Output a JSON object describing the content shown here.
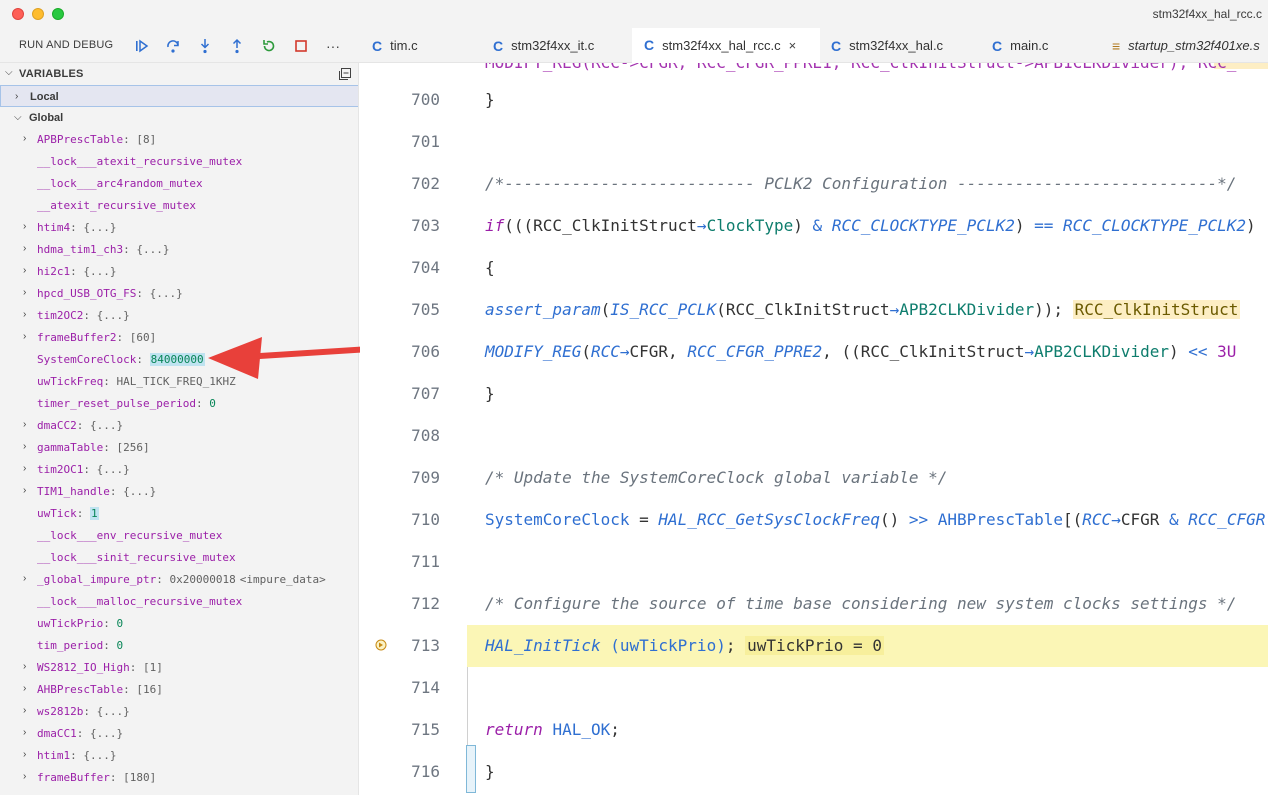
{
  "window": {
    "title": "stm32f4xx_hal_rcc.c"
  },
  "debug_toolbar": {
    "title": "RUN AND DEBUG",
    "buttons": [
      "continue-icon",
      "step-over-icon",
      "step-into-icon",
      "step-out-icon",
      "restart-icon",
      "stop-icon",
      "more-icon"
    ],
    "more_label": "···"
  },
  "tabs": [
    {
      "label": "tim.c",
      "active": false
    },
    {
      "label": "stm32f4xx_it.c",
      "active": false
    },
    {
      "label": "stm32f4xx_hal_rcc.c",
      "active": true,
      "close": "×"
    },
    {
      "label": "stm32f4xx_hal.c",
      "active": false
    },
    {
      "label": "main.c",
      "active": false
    },
    {
      "label": "startup_stm32f401xe.s",
      "active": false,
      "italic": true
    }
  ],
  "variables": {
    "header": "VARIABLES",
    "scopes": {
      "local": "Local",
      "global": "Global"
    },
    "items": [
      {
        "name": "APBPrescTable",
        "value": "[8]",
        "expandable": true,
        "kind": "plain"
      },
      {
        "name": "__lock___atexit_recursive_mutex",
        "value": "",
        "expandable": false,
        "kind": "plain"
      },
      {
        "name": "__lock___arc4random_mutex",
        "value": "",
        "expandable": false,
        "kind": "plain"
      },
      {
        "name": "__atexit_recursive_mutex",
        "value": "",
        "expandable": false,
        "kind": "plain"
      },
      {
        "name": "htim4",
        "value": "{...}",
        "expandable": true,
        "kind": "plain"
      },
      {
        "name": "hdma_tim1_ch3",
        "value": "{...}",
        "expandable": true,
        "kind": "plain"
      },
      {
        "name": "hi2c1",
        "value": "{...}",
        "expandable": true,
        "kind": "plain"
      },
      {
        "name": "hpcd_USB_OTG_FS",
        "value": "{...}",
        "expandable": true,
        "kind": "plain"
      },
      {
        "name": "tim2OC2",
        "value": "{...}",
        "expandable": true,
        "kind": "plain"
      },
      {
        "name": "frameBuffer2",
        "value": "[60]",
        "expandable": true,
        "kind": "plain"
      },
      {
        "name": "SystemCoreClock",
        "value": "84000000",
        "expandable": false,
        "kind": "highlight"
      },
      {
        "name": "uwTickFreq",
        "value": "HAL_TICK_FREQ_1KHZ",
        "expandable": false,
        "kind": "plain"
      },
      {
        "name": "timer_reset_pulse_period",
        "value": "0",
        "expandable": false,
        "kind": "number"
      },
      {
        "name": "dmaCC2",
        "value": "{...}",
        "expandable": true,
        "kind": "plain"
      },
      {
        "name": "gammaTable",
        "value": "[256]",
        "expandable": true,
        "kind": "plain"
      },
      {
        "name": "tim2OC1",
        "value": "{...}",
        "expandable": true,
        "kind": "plain"
      },
      {
        "name": "TIM1_handle",
        "value": "{...}",
        "expandable": true,
        "kind": "plain"
      },
      {
        "name": "uwTick",
        "value": "1",
        "expandable": false,
        "kind": "highlight"
      },
      {
        "name": "__lock___env_recursive_mutex",
        "value": "",
        "expandable": false,
        "kind": "plain"
      },
      {
        "name": "__lock___sinit_recursive_mutex",
        "value": "",
        "expandable": false,
        "kind": "plain"
      },
      {
        "name": "_global_impure_ptr",
        "value": "0x20000018",
        "extra": "<impure_data>",
        "expandable": true,
        "kind": "plain"
      },
      {
        "name": "__lock___malloc_recursive_mutex",
        "value": "",
        "expandable": false,
        "kind": "plain"
      },
      {
        "name": "uwTickPrio",
        "value": "0",
        "expandable": false,
        "kind": "number"
      },
      {
        "name": "tim_period",
        "value": "0",
        "expandable": false,
        "kind": "number"
      },
      {
        "name": "WS2812_IO_High",
        "value": "[1]",
        "expandable": true,
        "kind": "plain"
      },
      {
        "name": "AHBPrescTable",
        "value": "[16]",
        "expandable": true,
        "kind": "plain"
      },
      {
        "name": "ws2812b",
        "value": "{...}",
        "expandable": true,
        "kind": "plain"
      },
      {
        "name": "dmaCC1",
        "value": "{...}",
        "expandable": true,
        "kind": "plain"
      },
      {
        "name": "htim1",
        "value": "{...}",
        "expandable": true,
        "kind": "plain"
      },
      {
        "name": "frameBuffer",
        "value": "[180]",
        "expandable": true,
        "kind": "plain"
      }
    ]
  },
  "editor": {
    "top_partial": "MODIFY_REG(RCC->CFGR, RCC_CFGR_PPRE1, RCC_ClkInitStruct->APB1CLKDivider); RCC_",
    "current_line": 713,
    "lines": [
      {
        "n": "700",
        "tokens": [
          [
            "id",
            "}"
          ]
        ]
      },
      {
        "n": "701",
        "tokens": []
      },
      {
        "n": "702",
        "tokens": [
          [
            "cmt",
            "/*-------------------------- PCLK2 Configuration ---------------------------*/"
          ]
        ]
      },
      {
        "n": "703",
        "tokens": [
          [
            "kw",
            "if"
          ],
          [
            "id",
            "(((RCC_ClkInitStruct"
          ],
          [
            "op",
            "→"
          ],
          [
            "fld",
            "ClockType"
          ],
          [
            "id",
            ") "
          ],
          [
            "op",
            "&"
          ],
          [
            "id",
            " "
          ],
          [
            "mac",
            "RCC_CLOCKTYPE_PCLK2"
          ],
          [
            "id",
            ") "
          ],
          [
            "op",
            "=="
          ],
          [
            "id",
            " "
          ],
          [
            "mac",
            "RCC_CLOCKTYPE_PCLK2"
          ],
          [
            "id",
            ")"
          ]
        ]
      },
      {
        "n": "704",
        "tokens": [
          [
            "id",
            "{"
          ]
        ]
      },
      {
        "n": "705",
        "tokens": [
          [
            "id",
            "  "
          ],
          [
            "fn",
            "assert_param"
          ],
          [
            "id",
            "("
          ],
          [
            "mac",
            "IS_RCC_PCLK"
          ],
          [
            "id",
            "(RCC_ClkInitStruct"
          ],
          [
            "op",
            "→"
          ],
          [
            "fld",
            "APB2CLKDivider"
          ],
          [
            "id",
            ")); "
          ],
          [
            "inl",
            "RCC_ClkInitStruct"
          ]
        ]
      },
      {
        "n": "706",
        "tokens": [
          [
            "id",
            "  "
          ],
          [
            "fn",
            "MODIFY_REG"
          ],
          [
            "id",
            "("
          ],
          [
            "mac",
            "RCC"
          ],
          [
            "op",
            "→"
          ],
          [
            "id",
            "CFGR, "
          ],
          [
            "mac",
            "RCC_CFGR_PPRE2"
          ],
          [
            "id",
            ", ((RCC_ClkInitStruct"
          ],
          [
            "op",
            "→"
          ],
          [
            "fld",
            "APB2CLKDivider"
          ],
          [
            "id",
            ") "
          ],
          [
            "op",
            "<<"
          ],
          [
            "id",
            " "
          ],
          [
            "num",
            "3U"
          ]
        ]
      },
      {
        "n": "707",
        "tokens": [
          [
            "id",
            "}"
          ]
        ]
      },
      {
        "n": "708",
        "tokens": []
      },
      {
        "n": "709",
        "tokens": [
          [
            "cmt",
            "/* Update the SystemCoreClock global variable */"
          ]
        ]
      },
      {
        "n": "710",
        "tokens": [
          [
            "fn2",
            "SystemCoreClock"
          ],
          [
            "id",
            " = "
          ],
          [
            "fn",
            "HAL_RCC_GetSysClockFreq"
          ],
          [
            "id",
            "() "
          ],
          [
            "op",
            ">>"
          ],
          [
            "id",
            " "
          ],
          [
            "fn2",
            "AHBPrescTable"
          ],
          [
            "id",
            "[("
          ],
          [
            "mac",
            "RCC"
          ],
          [
            "op",
            "→"
          ],
          [
            "id",
            "CFGR "
          ],
          [
            "op",
            "&"
          ],
          [
            "id",
            " "
          ],
          [
            "mac",
            "RCC_CFGR"
          ]
        ]
      },
      {
        "n": "711",
        "tokens": []
      },
      {
        "n": "712",
        "tokens": [
          [
            "cmt",
            "/* Configure the source of time base considering new system clocks settings */"
          ]
        ]
      },
      {
        "n": "713",
        "tokens": [
          [
            "fn",
            "HAL_InitTick"
          ],
          [
            "id",
            " "
          ],
          [
            "fn2",
            "(uwTickPrio)"
          ],
          [
            "id",
            "; "
          ],
          [
            "inl2",
            "uwTickPrio = 0"
          ]
        ]
      },
      {
        "n": "714",
        "tokens": []
      },
      {
        "n": "715",
        "tokens": [
          [
            "kw",
            "return"
          ],
          [
            "id",
            " "
          ],
          [
            "fn2",
            "HAL_OK"
          ],
          [
            "id",
            ";"
          ]
        ]
      },
      {
        "n": "716",
        "tokens": [
          [
            "id",
            "}"
          ]
        ]
      }
    ]
  },
  "colors": {
    "accent": "#2f6fd1",
    "arrow": "#e8403a",
    "current_line": "#fbf6b6"
  }
}
